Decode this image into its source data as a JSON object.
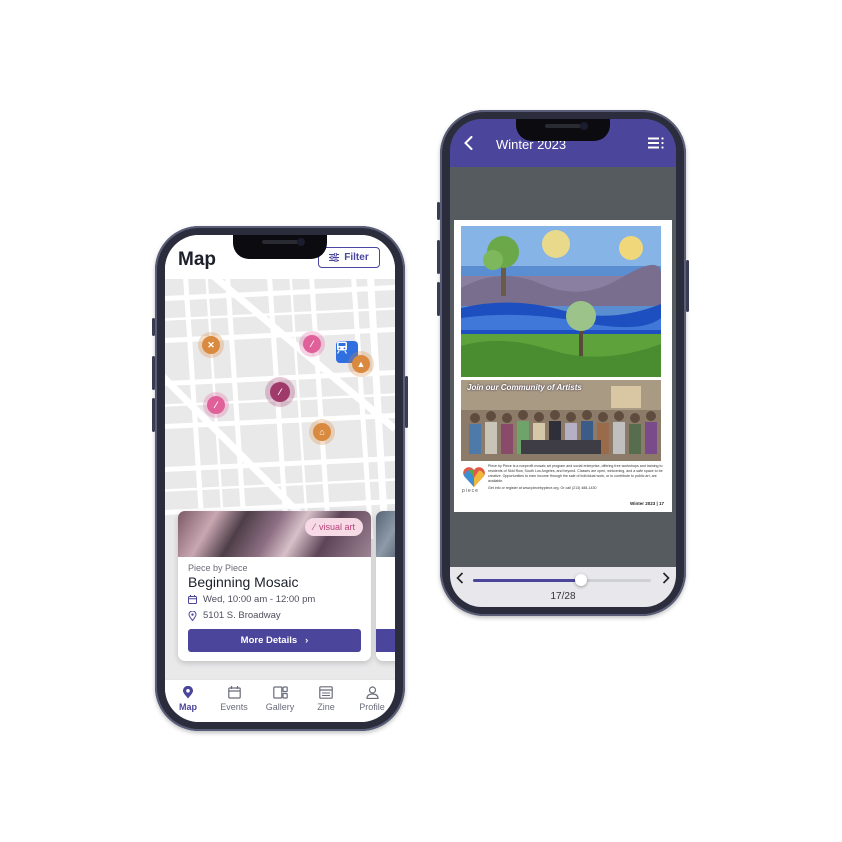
{
  "map_screen": {
    "title": "Map",
    "filter_label": "Filter",
    "event_card": {
      "category_tag": "visual art",
      "organizer": "Piece by Piece",
      "title": "Beginning Mosaic",
      "datetime": "Wed, 10:00 am - 12:00 pm",
      "address": "5101 S. Broadway",
      "cta": "More Details"
    },
    "tabs": [
      {
        "label": "Map",
        "icon": "map-pin-icon",
        "active": true
      },
      {
        "label": "Events",
        "icon": "calendar-icon",
        "active": false
      },
      {
        "label": "Gallery",
        "icon": "gallery-icon",
        "active": false
      },
      {
        "label": "Zine",
        "icon": "zine-icon",
        "active": false
      },
      {
        "label": "Profile",
        "icon": "profile-icon",
        "active": false
      }
    ],
    "pin_colors": {
      "orange": "#d98a3e",
      "pink": "#e0609a",
      "purple": "#a03a6a",
      "transit": "#2f6fe0"
    }
  },
  "zine_screen": {
    "title": "Winter 2023",
    "page_heading": "Join our Community of Artists",
    "logo_text": "piece",
    "info_text": "Piece by Piece is a nonprofit mosaic art program and social enterprise, offering free workshops and training to residents of Skid Row, South Los Angeles, and beyond. Classes are open, welcoming, and a safe space to be creative. Opportunities to earn income through the sale of individual work, or to contribute to public art, are available.",
    "contact_text": "Get info or register at www.piecebypiece.org. Or call (213) 488-1430",
    "footer": "Winter 2023 | 17",
    "page_indicator": "17/28",
    "progress": 0.607
  },
  "colors": {
    "accent": "#4b459b",
    "viewer_bg": "#555b5f"
  }
}
